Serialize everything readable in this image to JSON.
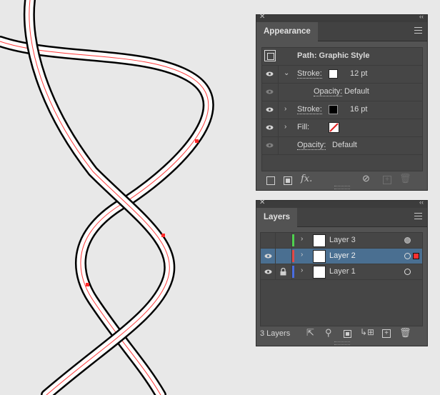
{
  "appearance": {
    "tab": "Appearance",
    "header_label": "Path: Graphic Style",
    "rows": [
      {
        "label": "Stroke:",
        "value": "12 pt",
        "swatch": "#ffffff",
        "expanded": true
      },
      {
        "label": "Opacity:",
        "value": "Default"
      },
      {
        "label": "Stroke:",
        "value": "16 pt",
        "swatch": "#000000",
        "expanded": false
      },
      {
        "label": "Fill:",
        "swatch": "none",
        "expanded": false
      },
      {
        "label": "Opacity:",
        "value": "Default"
      }
    ],
    "footer_fx": "fx."
  },
  "layers": {
    "tab": "Layers",
    "items": [
      {
        "name": "Layer 3",
        "color": "#4fd24f",
        "selected": false,
        "locked": false,
        "visible": false
      },
      {
        "name": "Layer 2",
        "color": "#e04a4a",
        "selected": true,
        "locked": false,
        "visible": true
      },
      {
        "name": "Layer 1",
        "color": "#4a6de0",
        "selected": false,
        "locked": true,
        "visible": true
      }
    ],
    "footer_count": "3 Layers"
  },
  "icons": [
    "close-icon",
    "collapse-icon",
    "panel-menu-icon",
    "eye-icon",
    "lock-icon",
    "chevron-right-icon",
    "chevron-down-icon",
    "new-art-stroke-icon",
    "new-art-fill-icon",
    "fx-icon",
    "clear-appearance-icon",
    "duplicate-item-icon",
    "delete-icon",
    "export-icon",
    "search-icon",
    "clipping-mask-icon",
    "create-sublayer-icon",
    "new-layer-icon",
    "trash-icon"
  ],
  "colors": {
    "panel_bg": "#535353",
    "selection_bg": "#4a6f91",
    "path_red": "#ff2a2a"
  }
}
